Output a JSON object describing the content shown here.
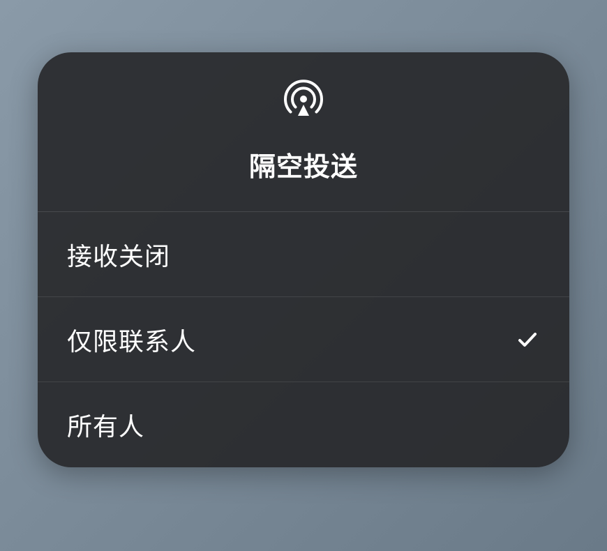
{
  "panel": {
    "title": "隔空投送",
    "icon": "airdrop-icon"
  },
  "options": [
    {
      "label": "接收关闭",
      "selected": false
    },
    {
      "label": "仅限联系人",
      "selected": true
    },
    {
      "label": "所有人",
      "selected": false
    }
  ]
}
